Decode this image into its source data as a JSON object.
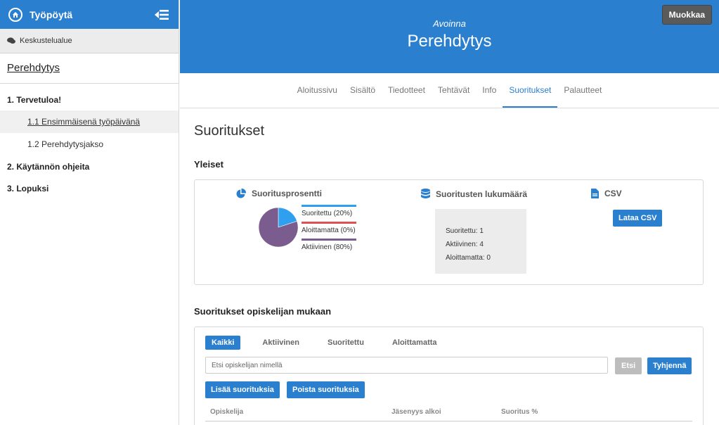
{
  "sidebar": {
    "top_title": "Työpöytä",
    "forum_label": "Keskustelualue",
    "course_link": "Perehdytys",
    "items": [
      {
        "label": "1. Tervetuloa!"
      },
      {
        "label": "1.1 Ensimmäisenä työpäivänä"
      },
      {
        "label": "1.2 Perehdytysjakso"
      },
      {
        "label": "2. Käytännön ohjeita"
      },
      {
        "label": "3. Lopuksi"
      }
    ]
  },
  "header": {
    "status": "Avoinna",
    "title": "Perehdytys",
    "edit_label": "Muokkaa"
  },
  "tabs": [
    {
      "label": "Aloitussivu"
    },
    {
      "label": "Sisältö"
    },
    {
      "label": "Tiedotteet"
    },
    {
      "label": "Tehtävät"
    },
    {
      "label": "Info"
    },
    {
      "label": "Suoritukset"
    },
    {
      "label": "Palautteet"
    }
  ],
  "main": {
    "page_title": "Suoritukset",
    "general_heading": "Yleiset",
    "percent": {
      "title": "Suoritusprosentti",
      "legend": [
        {
          "label": "Suoritettu (20%)",
          "color": "#2f9ff0",
          "value": 20
        },
        {
          "label": "Aloittamatta (0%)",
          "color": "#e05252",
          "value": 0
        },
        {
          "label": "Aktiivinen (80%)",
          "color": "#7b5c8e",
          "value": 80
        }
      ]
    },
    "count": {
      "title": "Suoritusten lukumäärä",
      "lines": [
        "Suoritettu: 1",
        "Aktiivinen: 4",
        "Aloittamatta: 0"
      ]
    },
    "csv": {
      "title": "CSV",
      "button": "Lataa CSV"
    },
    "students_heading": "Suoritukset opiskelijan mukaan",
    "filters": [
      "Kaikki",
      "Aktiivinen",
      "Suoritettu",
      "Aloittamatta"
    ],
    "search_placeholder": "Etsi opiskelijan nimellä",
    "search_button": "Etsi",
    "clear_button": "Tyhjennä",
    "add_button": "Lisää suorituksia",
    "remove_button": "Poista suorituksia",
    "columns": [
      "Opiskelija",
      "Jäsenyys alkoi",
      "Suoritus %"
    ]
  },
  "colors": {
    "brand": "#2a7fcf",
    "completed": "#2f9ff0",
    "not_started": "#e05252",
    "active": "#7b5c8e"
  }
}
